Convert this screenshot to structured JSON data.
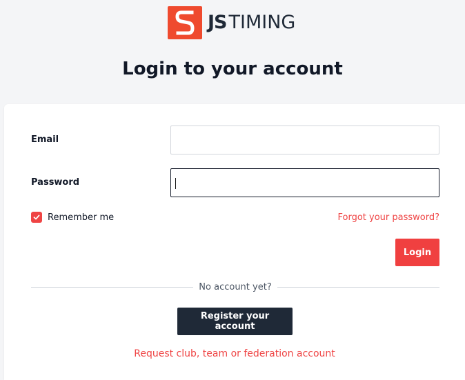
{
  "brand": {
    "logo_prefix": "JS",
    "logo_suffix": "TIMING",
    "accent_color": "#ef4a2e",
    "logo_icon": "s-logo-icon"
  },
  "page": {
    "title": "Login to your account"
  },
  "form": {
    "email_label": "Email",
    "email_value": "",
    "password_label": "Password",
    "password_value": "",
    "remember_label": "Remember me",
    "remember_checked": true,
    "forgot_label": "Forgot your password?",
    "login_label": "Login",
    "login_color": "#f04040"
  },
  "register": {
    "divider_text": "No account yet?",
    "register_label": "Register your account",
    "register_color": "#1f2937",
    "request_label": "Request club, team or federation account"
  }
}
